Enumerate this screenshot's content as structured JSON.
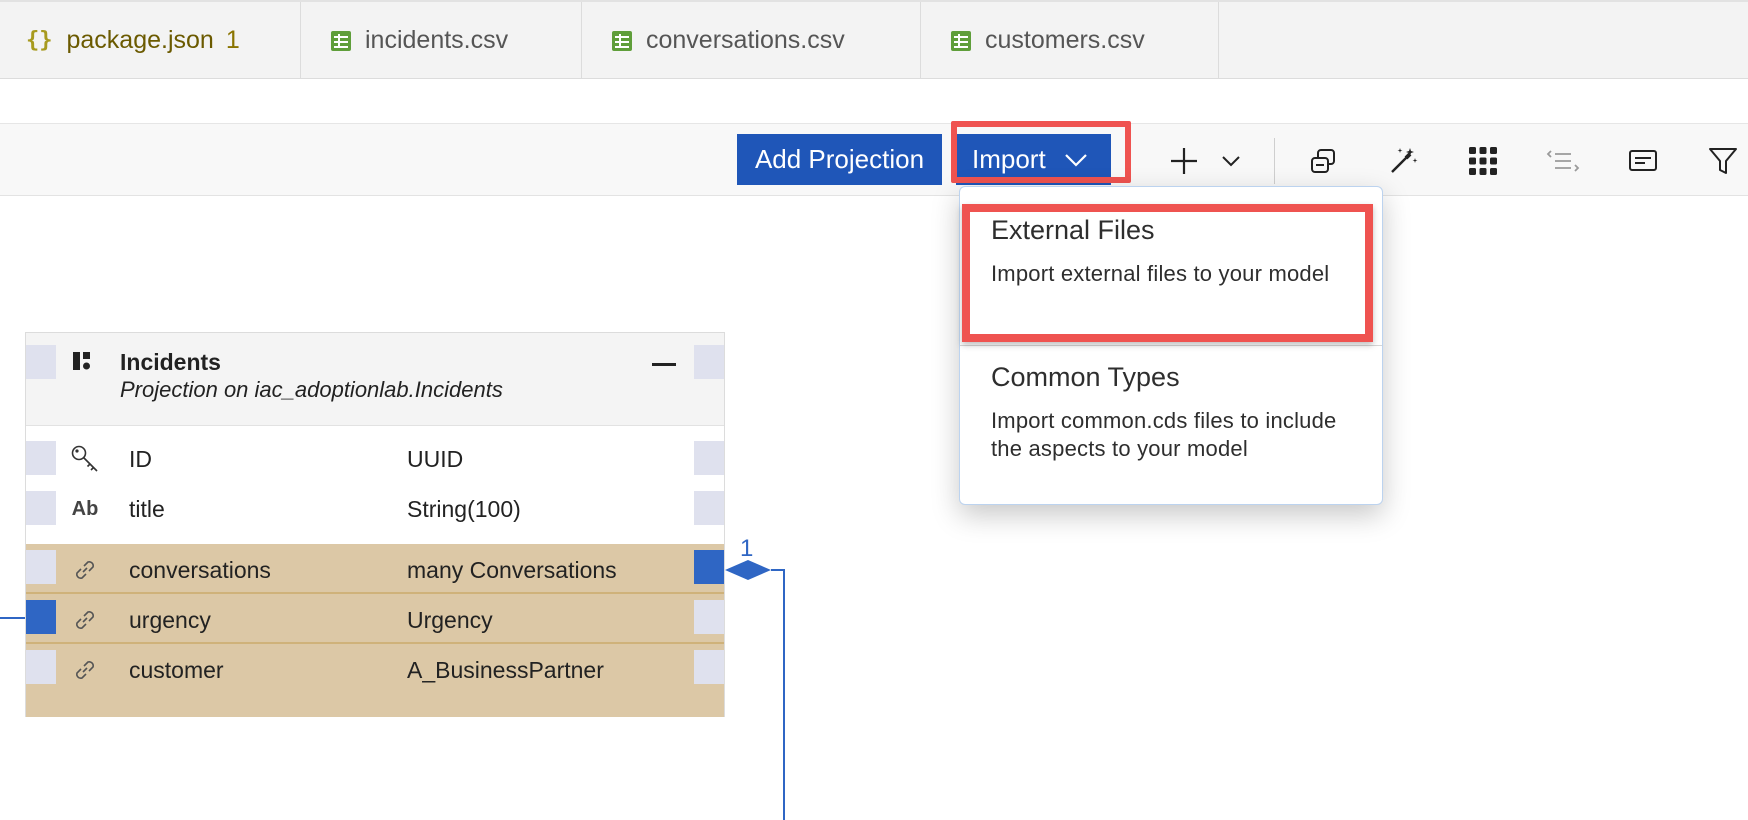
{
  "tabs": [
    {
      "label": "package.json",
      "badge": "1",
      "icon": "json-braces-icon",
      "brace": "{}"
    },
    {
      "label": "incidents.csv",
      "icon": "csv-file-icon"
    },
    {
      "label": "conversations.csv",
      "icon": "csv-file-icon"
    },
    {
      "label": "customers.csv",
      "icon": "csv-file-icon"
    }
  ],
  "toolbar": {
    "add_projection_label": "Add Projection",
    "import_label": "Import",
    "icons": [
      "add-icon",
      "dropdown-chevron-icon",
      "copy-icon",
      "magic-wand-icon",
      "grid-icon",
      "collapse-lines-icon",
      "comment-icon",
      "filter-icon"
    ]
  },
  "import_menu": {
    "items": [
      {
        "title": "External Files",
        "description": "Import external files to your model",
        "highlighted": true
      },
      {
        "title": "Common Types",
        "description": "Import common.cds files to include the aspects to your model"
      }
    ]
  },
  "entity": {
    "name": "Incidents",
    "subtitle": "Projection on iac_adoptionlab.Incidents",
    "fields": [
      {
        "name": "ID",
        "type": "UUID",
        "icon": "key-icon",
        "association": false
      },
      {
        "name": "title",
        "type": "String(100)",
        "icon": "text-type-icon",
        "icon_text": "Ab",
        "association": false
      },
      {
        "name": "conversations",
        "type": "many Conversations",
        "icon": "link-icon",
        "association": true
      },
      {
        "name": "urgency",
        "type": "Urgency",
        "icon": "link-icon",
        "association": true
      },
      {
        "name": "customer",
        "type": "A_BusinessPartner",
        "icon": "link-icon",
        "association": true
      }
    ]
  },
  "connector": {
    "multiplicity": "1"
  },
  "colors": {
    "primary_button": "#1f56b8",
    "highlight": "#ef5350",
    "association_row": "#dcc8a6",
    "port_active": "#2f66c4"
  }
}
